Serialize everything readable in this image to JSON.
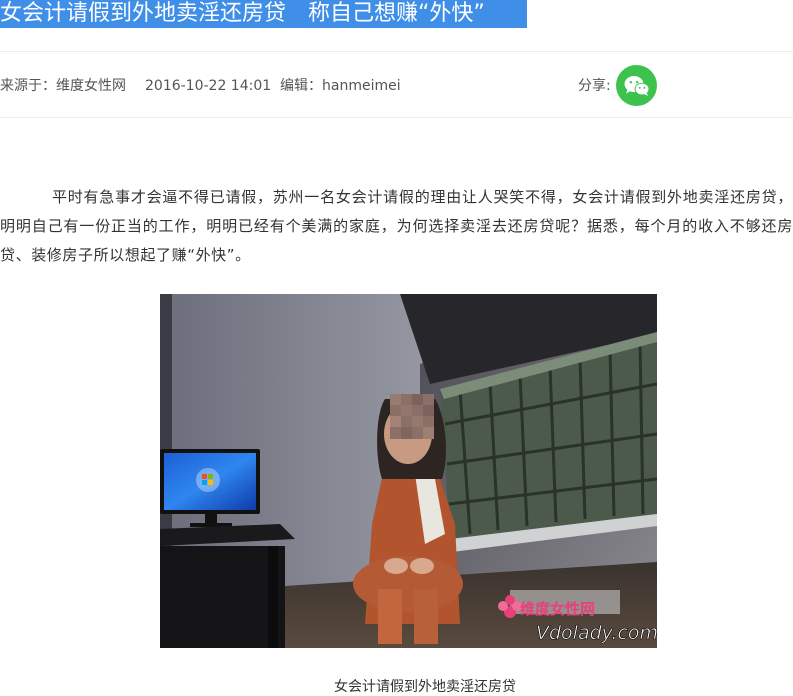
{
  "article": {
    "title": "女会计请假到外地卖淫还房贷　称自己想赚“外快”",
    "meta": {
      "source": "来源于：维度女性网",
      "date": "2016-10-22 14:01",
      "editor": "编辑：hanmeimei",
      "share_label": "分享:"
    },
    "paragraph": "平时有急事才会逼不得已请假，苏州一名女会计请假的理由让人哭笑不得，女会计请假到外地卖淫还房贷，明明自己有一份正当的工作，明明已经有个美满的家庭，为何选择卖淫去还房贷呢？据悉，每个月的收入不够还房贷、装修房子所以想起了赚“外快”。",
    "image": {
      "watermark_cn": "维度女性网",
      "watermark_en": "Vdolady.com"
    },
    "caption": "女会计请假到外地卖淫还房贷"
  },
  "icons": {
    "share": "wechat-icon"
  },
  "colors": {
    "title_highlight": "#3f8fe8",
    "wechat_green": "#3dc24d",
    "watermark_pink": "#e8407a"
  }
}
